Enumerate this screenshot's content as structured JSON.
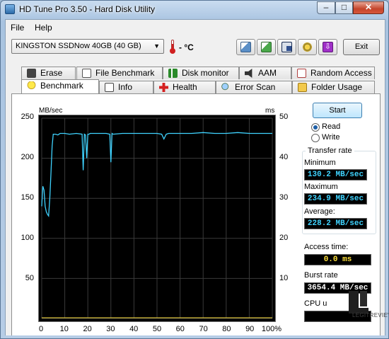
{
  "window": {
    "title": "HD Tune Pro 3.50 - Hard Disk Utility"
  },
  "menu": {
    "file": "File",
    "help": "Help"
  },
  "toolbar": {
    "drive": "KINGSTON SSDNow 40GB (40 GB)",
    "temperature": "- °C",
    "exit_label": "Exit",
    "icons": [
      "copy-text-icon",
      "copy-info-icon",
      "save-icon",
      "options-icon",
      "download-icon"
    ]
  },
  "tabs_back": [
    {
      "label": "Erase",
      "icon": "trash-icon"
    },
    {
      "label": "File Benchmark",
      "icon": "file-benchmark-icon"
    },
    {
      "label": "Disk monitor",
      "icon": "disk-monitor-icon"
    },
    {
      "label": "AAM",
      "icon": "speaker-icon"
    },
    {
      "label": "Random Access",
      "icon": "random-access-icon"
    }
  ],
  "tabs_front": [
    {
      "label": "Benchmark",
      "icon": "lightbulb-icon"
    },
    {
      "label": "Info",
      "icon": "info-icon"
    },
    {
      "label": "Health",
      "icon": "health-cross-icon"
    },
    {
      "label": "Error Scan",
      "icon": "magnifier-icon"
    },
    {
      "label": "Folder Usage",
      "icon": "folder-icon"
    }
  ],
  "benchmark": {
    "start_label": "Start",
    "read_label": "Read",
    "write_label": "Write",
    "selected_mode": "Read",
    "transfer_rate_title": "Transfer rate",
    "minimum_label": "Minimum",
    "minimum_value": "130.2 MB/sec",
    "maximum_label": "Maximum",
    "maximum_value": "234.9 MB/sec",
    "average_label": "Average:",
    "average_value": "228.2 MB/sec",
    "access_label": "Access time:",
    "access_value": "0.0 ms",
    "burst_label": "Burst rate",
    "burst_value": "3654.4 MB/sec",
    "cpu_label": "CPU u",
    "cpu_value": ""
  },
  "watermark_text": "LEGITREVIEWS",
  "colors": {
    "read_line": "#3fd3ff",
    "access_points": "#ffe13c",
    "chart_bg": "#000000",
    "grid": "#3a3a3a"
  },
  "chart_data": {
    "type": "line",
    "left_axis_unit": "MB/sec",
    "right_axis_unit": "ms",
    "left_ticks": [
      "250",
      "200",
      "150",
      "100",
      "50"
    ],
    "right_ticks": [
      "50",
      "40",
      "30",
      "20",
      "10"
    ],
    "x_ticks": [
      "0",
      "10",
      "20",
      "30",
      "40",
      "50",
      "60",
      "70",
      "80",
      "90",
      "100%"
    ],
    "ylim": [
      0,
      250
    ],
    "y2lim": [
      0,
      50
    ],
    "xlim": [
      0,
      100
    ],
    "series": [
      {
        "name": "Read",
        "x": [
          0,
          0.5,
          1,
          1.5,
          2,
          2.5,
          3,
          3.5,
          4,
          4.5,
          5,
          6,
          7,
          8,
          10,
          12,
          15,
          17.5,
          18,
          18.5,
          19,
          19.5,
          20,
          20.5,
          21,
          25,
          28,
          29.5,
          30,
          30.5,
          31,
          35,
          40,
          45,
          50,
          52,
          53,
          54,
          55,
          60,
          65,
          70,
          75,
          80,
          85,
          90,
          95,
          100
        ],
        "values": [
          140,
          165,
          160,
          140,
          133,
          130,
          128,
          150,
          180,
          215,
          230,
          230,
          229,
          231,
          231,
          230,
          231,
          230,
          185,
          230,
          229,
          200,
          230,
          230,
          231,
          231,
          231,
          230,
          195,
          231,
          230,
          231,
          231,
          231,
          231,
          230,
          224,
          230,
          231,
          231,
          231,
          232,
          231,
          231,
          232,
          231,
          231,
          231
        ]
      },
      {
        "name": "Access time",
        "x": [
          0,
          10,
          20,
          30,
          40,
          50,
          60,
          70,
          80,
          90,
          100
        ],
        "values": [
          0,
          0,
          0,
          0,
          0,
          0,
          0,
          0,
          0,
          0,
          0
        ]
      }
    ]
  }
}
